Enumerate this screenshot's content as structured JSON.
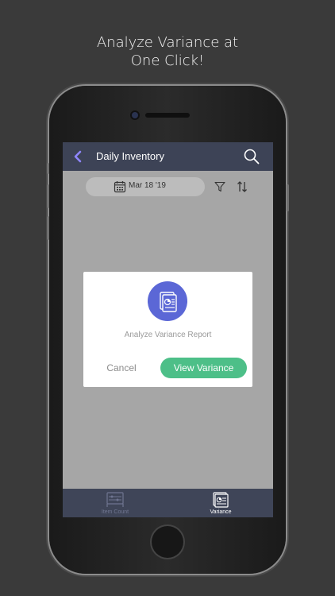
{
  "headline": {
    "line1": "Analyze Variance at",
    "line2": "One Click!"
  },
  "navbar": {
    "title": "Daily Inventory",
    "back_icon": "chevron-left-icon",
    "search_icon": "search-icon"
  },
  "toolbar": {
    "date": "Mar 18 '19",
    "calendar_icon": "calendar-icon",
    "filter_icon": "filter-icon",
    "sort_icon": "sort-icon"
  },
  "dialog": {
    "icon": "variance-report-icon",
    "message": "Analyze Variance Report",
    "cancel_label": "Cancel",
    "confirm_label": "View Variance"
  },
  "tabbar": {
    "tabs": [
      {
        "label": "Item Count",
        "icon": "item-count-icon",
        "active": false
      },
      {
        "label": "Variance",
        "icon": "variance-icon",
        "active": true
      }
    ]
  },
  "colors": {
    "background": "#3a3a3a",
    "navbar": "#3d4356",
    "accent_purple": "#5b67d6",
    "back_chevron": "#8f86ff",
    "confirm_green": "#4dbf88",
    "overlay": "#a6a6a6"
  }
}
